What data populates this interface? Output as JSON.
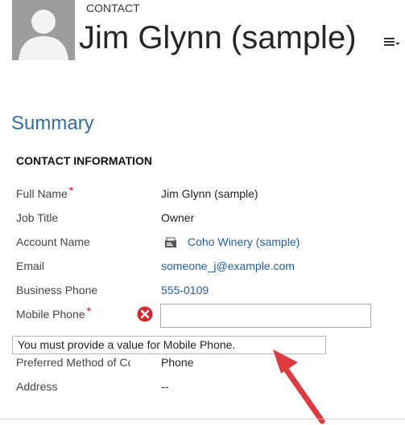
{
  "header": {
    "entity_type": "CONTACT",
    "record_name": "Jim Glynn (sample)"
  },
  "section": {
    "title": "Summary",
    "group_title": "CONTACT INFORMATION"
  },
  "fields": [
    {
      "label": "Full Name",
      "value": "Jim Glynn (sample)",
      "required": "*"
    },
    {
      "label": "Job Title",
      "value": "Owner"
    },
    {
      "label": "Account Name",
      "value": "Coho Winery (sample)"
    },
    {
      "label": "Email",
      "value": "someone_j@example.com"
    },
    {
      "label": "Business Phone",
      "value": "555-0109"
    },
    {
      "label": "Mobile Phone",
      "value": "",
      "required": "*"
    },
    {
      "label": "Preferred Method of Contact",
      "value": "Phone"
    },
    {
      "label": "Address",
      "value": "--"
    }
  ],
  "validation": {
    "message": "You must provide a value for Mobile Phone."
  },
  "colors": {
    "link": "#1a5fa8",
    "section_title": "#2f6da6",
    "required": "#d0021b",
    "error": "#d9262b",
    "arrow": "#e03a3e"
  },
  "icons": {
    "avatar": "person-silhouette",
    "menu": "list-menu-icon",
    "lookup": "account-card-icon",
    "error": "error-x-icon"
  }
}
